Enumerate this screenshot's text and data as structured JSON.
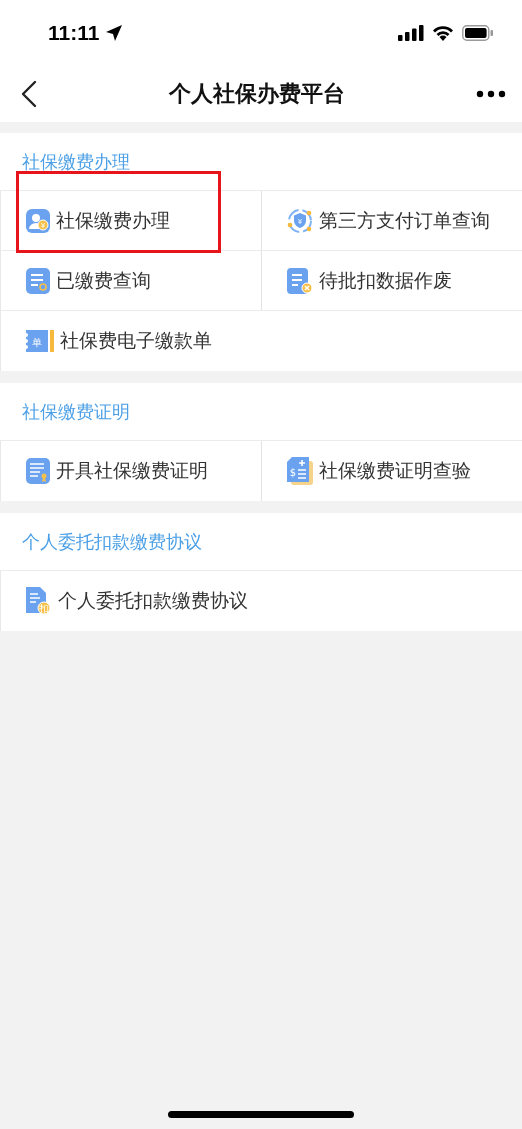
{
  "status_bar": {
    "time": "11:11"
  },
  "nav": {
    "title": "个人社保办费平台"
  },
  "sections": [
    {
      "title": "社保缴费办理",
      "items": [
        {
          "label": "社保缴费办理",
          "kind": "person-coin",
          "icon_text": "¥",
          "highlighted": true
        },
        {
          "label": "第三方支付订单查询",
          "kind": "shield",
          "icon_text": "¥",
          "highlighted": false
        },
        {
          "label": "已缴费查询",
          "kind": "doc-search",
          "highlighted": false
        },
        {
          "label": "待批扣数据作废",
          "kind": "doc-cancel",
          "highlighted": false
        },
        {
          "label": "社保费电子缴款单",
          "kind": "receipt",
          "icon_text": "单",
          "highlighted": false
        }
      ]
    },
    {
      "title": "社保缴费证明",
      "items": [
        {
          "label": "开具社保缴费证明",
          "kind": "doc-award",
          "highlighted": false
        },
        {
          "label": "社保缴费证明查验",
          "kind": "doc-dollar",
          "icon_text": "$",
          "highlighted": false
        }
      ]
    },
    {
      "title": "个人委托扣款缴费协议",
      "items": [
        {
          "label": "个人委托扣款缴费协议",
          "kind": "doc-badge",
          "icon_text": "扣",
          "highlighted": false
        }
      ]
    }
  ]
}
